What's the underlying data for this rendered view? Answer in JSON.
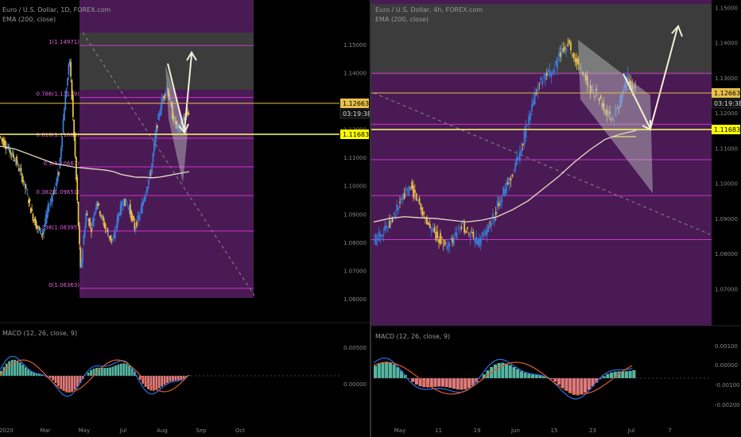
{
  "left_pane": {
    "legend_title": "Euro / U.S. Dollar, 1D, FOREX.com",
    "ema_label": "EMA (200, close)",
    "macd_label": "MACD (12, 26, close, 9)",
    "price_label_current": "1.12663",
    "price_label_timer": "03:19:38",
    "price_label_level": "1.11683",
    "x_ticks": [
      "2020",
      "Mar",
      "May",
      "Jul",
      "Aug",
      "Sep",
      "Oct"
    ],
    "fib_labels": [
      "1(1.14971)",
      "0.786(1.13129)",
      "0.618(1.11683)",
      "0.5(1.10667)",
      "0.382(1.09651)",
      "0.236(1.08395)",
      "0(1.06363)"
    ]
  },
  "right_pane": {
    "legend_title": "Euro / U.S. Dollar, 4h, FOREX.com",
    "ema_label": "EMA (200, close)",
    "macd_label": "MACD (12, 26, close, 9)",
    "price_label_current": "1.12663",
    "price_label_timer": "03:19:38",
    "price_label_level": "1.11683",
    "x_ticks": [
      "May",
      "11",
      "19",
      "Jun",
      "15",
      "23",
      "Jul",
      "7"
    ]
  },
  "colors": {
    "background": "#000000",
    "fib_zone": "#4a1a55",
    "fib_top_zone": "#3c3c3c",
    "fib_line": "#cc33cc",
    "price_line": "#e8c04a",
    "ema": "#e8dcc4",
    "candle_up": "#3a7bd5",
    "candle_down": "#e8c04a",
    "macd_line": "#2f6fe0",
    "signal_line": "#e05a2a",
    "hist_up": "#56b5a0",
    "hist_down": "#e07a7a",
    "arrow": "#f0f0d8",
    "label_bg": "#ffff00"
  },
  "chart_data": [
    {
      "type": "candlestick",
      "title": "Euro / U.S. Dollar, 1D, FOREX.com",
      "y_ticks": [
        "1.15000",
        "1.14000",
        "1.13000",
        "1.12000",
        "1.11000",
        "1.10000",
        "1.09000",
        "1.08000",
        "1.07000",
        "1.06000"
      ],
      "ylim": [
        1.056,
        1.163
      ],
      "x_ticks": [
        "2020",
        "Mar",
        "May",
        "Jul",
        "Aug",
        "Sep",
        "Oct"
      ],
      "fib_levels": [
        {
          "ratio": 1,
          "price": 1.14971
        },
        {
          "ratio": 0.786,
          "price": 1.13129
        },
        {
          "ratio": 0.618,
          "price": 1.11683
        },
        {
          "ratio": 0.5,
          "price": 1.10667
        },
        {
          "ratio": 0.382,
          "price": 1.09651
        },
        {
          "ratio": 0.236,
          "price": 1.08395
        },
        {
          "ratio": 0,
          "price": 1.06363
        }
      ],
      "current_price": 1.12663,
      "level_price": 1.11683,
      "close_path": [
        1.1175,
        1.115,
        1.112,
        1.109,
        1.104,
        1.098,
        1.09,
        1.085,
        1.083,
        1.092,
        1.098,
        1.105,
        1.128,
        1.145,
        1.11,
        1.07,
        1.09,
        1.085,
        1.095,
        1.088,
        1.083,
        1.08,
        1.09,
        1.095,
        1.092,
        1.085,
        1.09,
        1.098,
        1.105,
        1.12,
        1.13,
        1.135,
        1.125,
        1.12,
        1.123,
        1.126
      ],
      "ema200": [
        1.114,
        1.1135,
        1.113,
        1.112,
        1.111,
        1.11,
        1.109,
        1.108,
        1.1075,
        1.107,
        1.1065,
        1.1063,
        1.106,
        1.1058,
        1.1055,
        1.105,
        1.104,
        1.1035,
        1.103,
        1.103,
        1.1028,
        1.103,
        1.1035,
        1.104,
        1.1045,
        1.105
      ]
    },
    {
      "type": "candlestick",
      "title": "Euro / U.S. Dollar, 4h, FOREX.com",
      "y_ticks": [
        "1.15000",
        "1.14000",
        "1.13000",
        "1.12000",
        "1.11000",
        "1.10000",
        "1.09000",
        "1.08000",
        "1.07000"
      ],
      "ylim": [
        1.064,
        1.151
      ],
      "x_ticks": [
        "May",
        "11",
        "19",
        "Jun",
        "15",
        "23",
        "Jul",
        "7"
      ],
      "current_price": 1.12663,
      "level_price": 1.11683,
      "close_path": [
        1.083,
        1.086,
        1.088,
        1.092,
        1.096,
        1.099,
        1.095,
        1.09,
        1.086,
        1.084,
        1.082,
        1.085,
        1.088,
        1.085,
        1.083,
        1.086,
        1.09,
        1.096,
        1.1,
        1.105,
        1.112,
        1.12,
        1.128,
        1.13,
        1.132,
        1.137,
        1.14,
        1.135,
        1.131,
        1.127,
        1.125,
        1.12,
        1.118,
        1.124,
        1.13,
        1.126
      ],
      "ema200": [
        1.089,
        1.09,
        1.0905,
        1.0902,
        1.09,
        1.0895,
        1.089,
        1.0895,
        1.0905,
        1.0925,
        1.095,
        1.0985,
        1.102,
        1.106,
        1.1095,
        1.1125,
        1.114,
        1.115
      ]
    }
  ]
}
